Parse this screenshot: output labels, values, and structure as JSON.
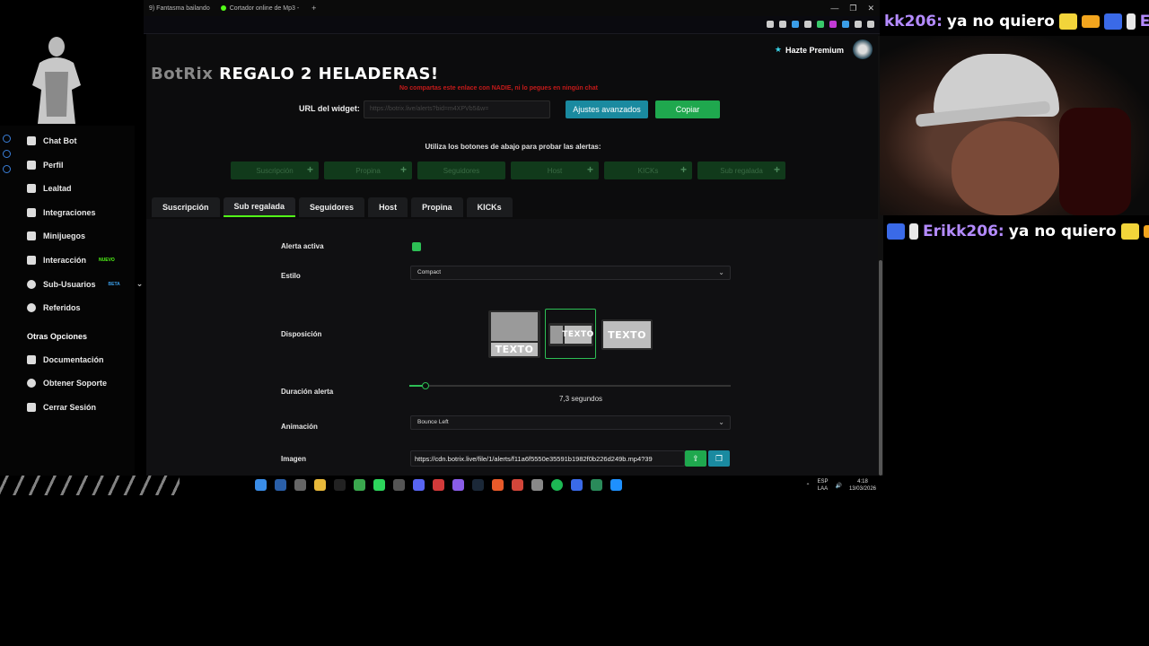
{
  "browser": {
    "tabs": [
      {
        "label": "9) Fantasma bailando"
      },
      {
        "label": "Cortador online de Mp3 -"
      }
    ],
    "new_tab_symbol": "+",
    "window_controls": [
      "—",
      "❐",
      "✕"
    ]
  },
  "app": {
    "premium_label": "Hazte Premium",
    "title_prefix": "BotRix",
    "title_main": "REGALO 2 HELADERAS!",
    "warning": "No compartas este enlace con NADIE, ni lo pegues en ningún chat",
    "url_label": "URL del widget:",
    "url_value": "https://botrix.live/alerts?bid=m4XPVb5&w=",
    "adv_button": "Ajustes avanzados",
    "copy_button": "Copiar",
    "test_prompt": "Utiliza los botones de abajo para probar las alertas:",
    "test_buttons": [
      {
        "label": "Suscripción"
      },
      {
        "label": "Propina"
      },
      {
        "label": "Seguidores"
      },
      {
        "label": "Host"
      },
      {
        "label": "KICKs"
      },
      {
        "label": "Sub regalada"
      }
    ],
    "tabs": [
      {
        "label": "Suscripción"
      },
      {
        "label": "Sub regalada"
      },
      {
        "label": "Seguidores"
      },
      {
        "label": "Host"
      },
      {
        "label": "Propina"
      },
      {
        "label": "KICKs"
      }
    ],
    "active_tab": "Sub regalada",
    "form": {
      "alert_active_label": "Alerta activa",
      "alert_active": true,
      "style_label": "Estilo",
      "style_value": "Compact",
      "layout_label": "Disposición",
      "layout_option_text": "TEXTO",
      "layout_selected_index": 1,
      "duration_label": "Duración alerta",
      "duration_value_text": "7,3 segundos",
      "duration_fraction": 0.05,
      "animation_label": "Animación",
      "animation_value": "Bounce Left",
      "image_label": "Imagen",
      "image_value": "https://cdn.botrix.live/file/1/alerts/f11a6f5550e35591b1982f0b226d249b.mp4?39"
    }
  },
  "sidebar": {
    "items": [
      {
        "label": "Chat Bot"
      },
      {
        "label": "Perfil"
      },
      {
        "label": "Lealtad"
      },
      {
        "label": "Integraciones"
      },
      {
        "label": "Minijuegos"
      },
      {
        "label": "Interacción",
        "badge": "NUEVO"
      },
      {
        "label": "Sub-Usuarios",
        "badge": "BETA"
      },
      {
        "label": "Referidos"
      }
    ],
    "section_title": "Otras Opciones",
    "other_items": [
      {
        "label": "Documentación"
      },
      {
        "label": "Obtener Soporte"
      },
      {
        "label": "Cerrar Sesión"
      }
    ]
  },
  "taskbar": {
    "lang_top": "ESP",
    "lang_bottom": "LAA",
    "time": "4:18",
    "date": "13/03/2026"
  },
  "overlay": {
    "chat_top_name": "kk206:",
    "chat_top_msg": "ya no quiero",
    "chat_top_tail": "Erik",
    "chat_bottom_name": "Erikk206:",
    "chat_bottom_msg": "ya no quiero"
  },
  "colors": {
    "accent_green": "#53fc18",
    "button_teal": "#1a8aa0",
    "button_green": "#1fa84e",
    "warning_red": "#c61a1a"
  }
}
